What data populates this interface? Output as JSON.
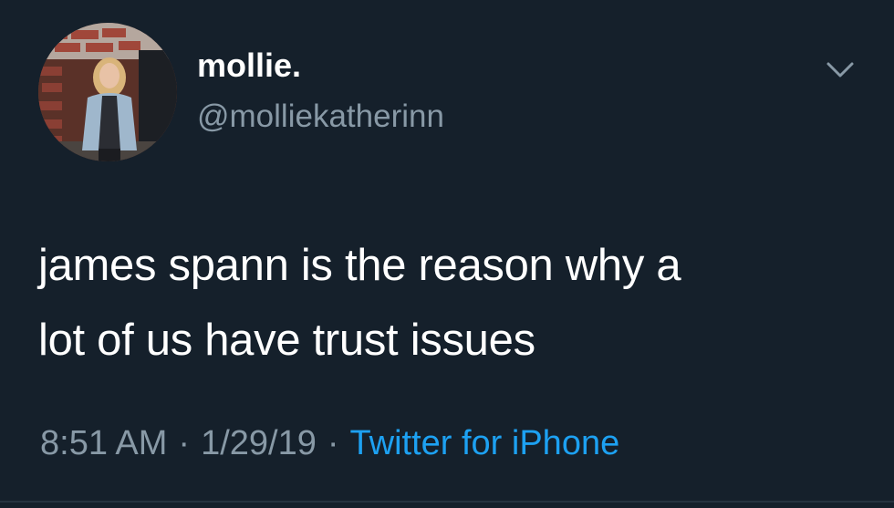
{
  "tweet": {
    "display_name": "mollie.",
    "handle": "@molliekatherinn",
    "text_lines": [
      "james spann is the reason why a",
      "lot of us have trust issues"
    ],
    "time": "8:51 AM",
    "date": "1/29/19",
    "separator": "·",
    "source": "Twitter for iPhone",
    "avatar_icon": "profile-photo",
    "menu_icon": "chevron-down-icon"
  },
  "colors": {
    "background": "#15202b",
    "text_primary": "#ffffff",
    "text_secondary": "#8899a6",
    "link": "#1da1f2"
  }
}
